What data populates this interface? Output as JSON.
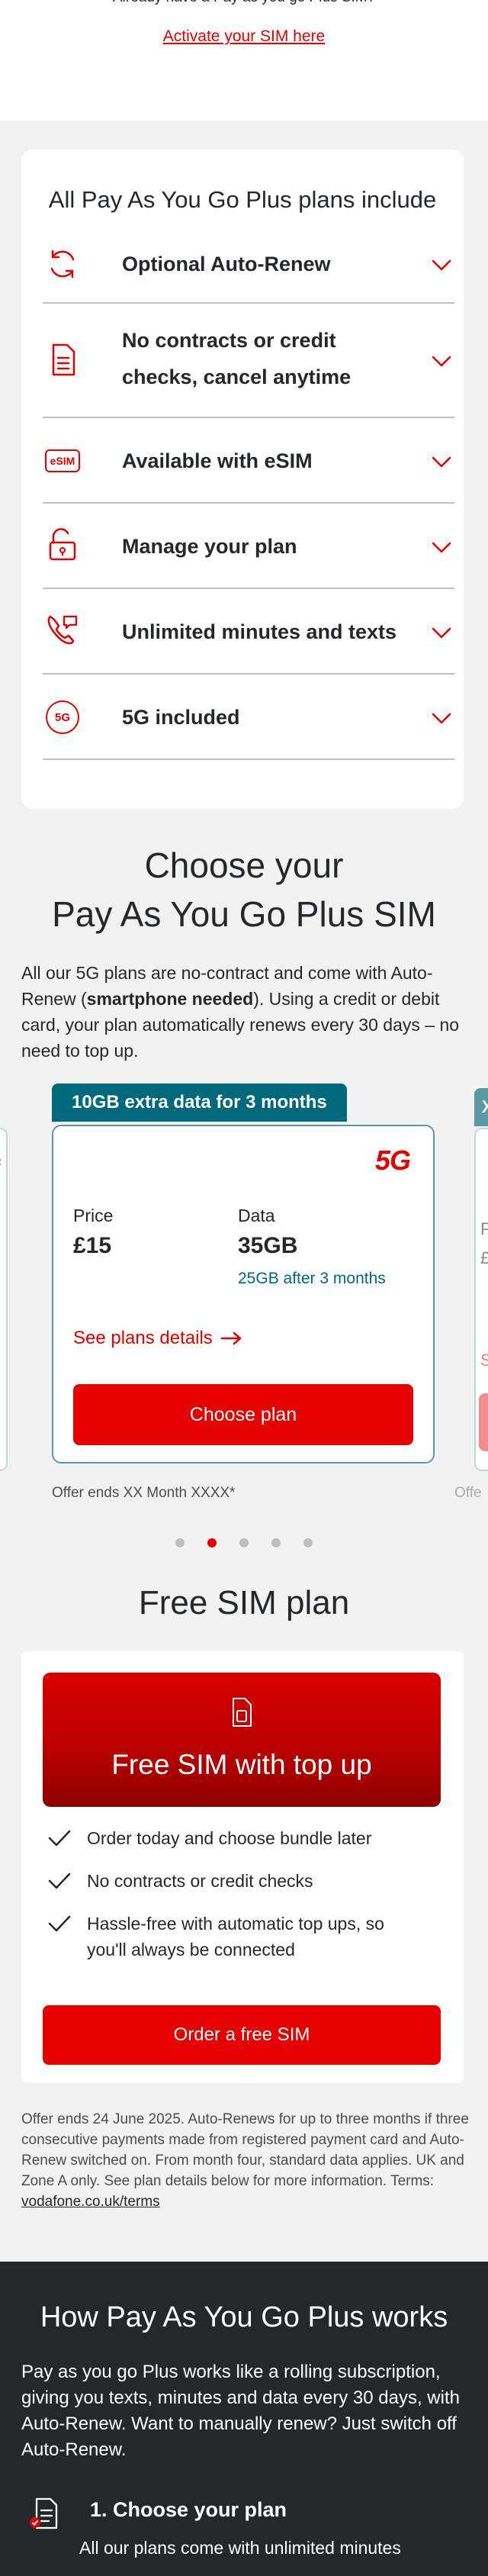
{
  "top": {
    "partial_text": "Already have a Pay as you go Plus SIM?",
    "activate_link": "Activate your SIM here"
  },
  "includes": {
    "title": "All Pay As You Go Plus plans include",
    "items": [
      {
        "icon": "refresh-icon",
        "label": "Optional Auto-Renew"
      },
      {
        "icon": "document-icon",
        "label": "No contracts or credit checks, cancel anytime"
      },
      {
        "icon": "esim-icon",
        "label": "Available with eSIM"
      },
      {
        "icon": "unlock-icon",
        "label": "Manage your plan"
      },
      {
        "icon": "phone-chat-icon",
        "label": "Unlimited minutes and texts"
      },
      {
        "icon": "5g-icon",
        "label": "5G included"
      }
    ],
    "esim_badge": "eSIM",
    "fiveg_badge": "5G"
  },
  "choose": {
    "title_line1": "Choose your",
    "title_line2": "Pay As You Go Plus SIM",
    "desc_part1": "All our 5G plans are no-contract and come with Auto-Renew (",
    "desc_bold": "smartphone needed",
    "desc_part2": "). Using a credit or debit card, your plan automatically renews every 30 days – no need to top up."
  },
  "plan": {
    "tab": "10GB extra data for 3 months",
    "badge": "5G",
    "price_label": "Price",
    "price_value": "£15",
    "data_label": "Data",
    "data_value": "35GB",
    "data_after": "25GB after 3 months",
    "details_link": "See plans details",
    "choose_button": "Choose plan",
    "offer_ends": "Offer ends XX Month XXXX*",
    "peek_left_badge": "G",
    "peek_right_tab": "X",
    "peek_right_price": "P",
    "peek_right_price2": "£",
    "peek_right_link": "S",
    "peek_offer": "Offe"
  },
  "carousel": {
    "dots": 5,
    "active_index": 1
  },
  "free_sim": {
    "title": "Free SIM plan",
    "banner_text": "Free SIM with top up",
    "bullets": [
      "Order today and choose bundle later",
      "No contracts or credit checks",
      "Hassle-free with automatic top ups, so you'll always be connected"
    ],
    "order_button": "Order a free SIM"
  },
  "terms": {
    "text": "Offer ends 24 June 2025. Auto-Renews for up to three months if three consecutive payments made from registered payment card and Auto-Renew switched on. From month four, standard data applies. UK and Zone A only. See plan details below for more information. Terms: ",
    "link": "vodafone.co.uk/terms"
  },
  "how": {
    "title": "How Pay As You Go Plus works",
    "desc": "Pay as you go Plus works like a rolling subscription, giving you texts, minutes and data every 30 days, with Auto-Renew. Want to manually renew? Just switch off Auto-Renew.",
    "step1_title": "1. Choose your plan",
    "step1_desc": "All our plans come with unlimited minutes"
  },
  "colors": {
    "brand_red": "#e60000",
    "teal": "#00697c",
    "dark_bg": "#25282b"
  }
}
